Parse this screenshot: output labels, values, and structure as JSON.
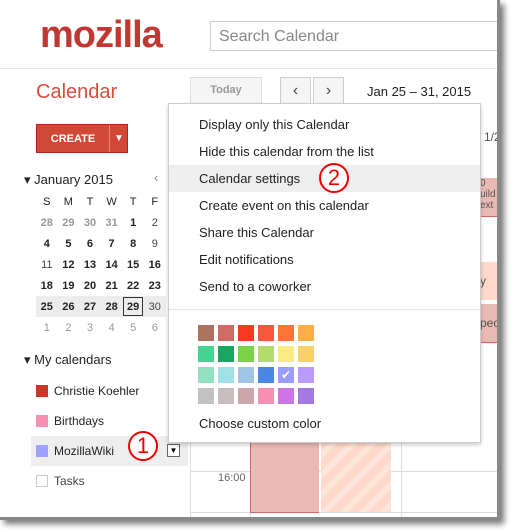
{
  "header": {
    "logo": "mozilla",
    "search_placeholder": "Search Calendar"
  },
  "app": {
    "title": "Calendar",
    "today": "Today",
    "prev": "‹",
    "next": "›",
    "date_range": "Jan 25 – 31, 2015",
    "create": "CREATE",
    "create_dropdown": "▼"
  },
  "mini_calendar": {
    "month": "January 2015",
    "weekdays": [
      "S",
      "M",
      "T",
      "W",
      "T",
      "F"
    ],
    "weeks": [
      [
        "28",
        "29",
        "30",
        "31",
        "1",
        "2"
      ],
      [
        "4",
        "5",
        "6",
        "7",
        "8",
        "9"
      ],
      [
        "11",
        "12",
        "13",
        "14",
        "15",
        "16"
      ],
      [
        "18",
        "19",
        "20",
        "21",
        "22",
        "23"
      ],
      [
        "25",
        "26",
        "27",
        "28",
        "29",
        "30"
      ],
      [
        "1",
        "2",
        "3",
        "4",
        "5",
        "6"
      ]
    ],
    "selected": "29"
  },
  "my_calendars": {
    "label": "My calendars",
    "items": [
      {
        "name": "Christie Koehler",
        "color": "#c53929"
      },
      {
        "name": "Birthdays",
        "color": "#f691b2"
      },
      {
        "name": "MozillaWiki",
        "color": "#9fa0ff"
      },
      {
        "name": "Tasks",
        "color": "#ffffff"
      }
    ]
  },
  "grid": {
    "time_label": "16:00",
    "header_fragment": "1/2",
    "event_fragments": [
      "0",
      "uild",
      "ext",
      "y P",
      "pec"
    ]
  },
  "menu": {
    "items": [
      "Display only this Calendar",
      "Hide this calendar from the list",
      "Calendar settings",
      "Create event on this calendar",
      "Share this Calendar",
      "Edit notifications",
      "Send to a coworker"
    ],
    "highlighted": "Calendar settings",
    "custom_color": "Choose custom color",
    "colors": [
      [
        "#ac725e",
        "#d06b64",
        "#f83a22",
        "#fa573c",
        "#ff7537",
        "#ffad46"
      ],
      [
        "#42d692",
        "#16a765",
        "#7bd148",
        "#b3dc6c",
        "#fbe983",
        "#fad165"
      ],
      [
        "#92e1c0",
        "#9fe1e7",
        "#9fc6e7",
        "#4986e7",
        "#9a9cff",
        "#b99aff"
      ],
      [
        "#c2c2c2",
        "#cabdbf",
        "#cca6ac",
        "#f691b2",
        "#cd74e6",
        "#a47ae2"
      ]
    ],
    "selected_color": "#9a9cff"
  },
  "annotations": [
    "1",
    "2"
  ]
}
